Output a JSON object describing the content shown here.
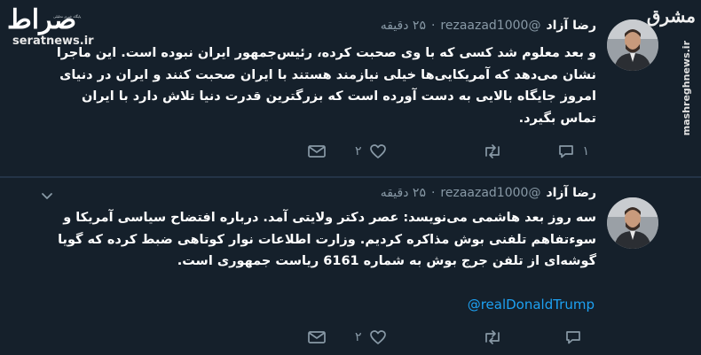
{
  "watermarks": {
    "left_logo": "صراط",
    "left_subtitle": "پایگاه خبری تحلیلی",
    "left_site": "seratnews.ir",
    "right_logo": "مشرق",
    "right_site": "mashreghnews.ir"
  },
  "tweets": [
    {
      "author": "رضا آزاد",
      "handle": "@rezaazad1000",
      "separator": "·",
      "time": "۲۵ دقیقه",
      "text": "و بعد معلوم شد کسی که با وی صحبت کرده، رئیس‌جمهور ایران نبوده است. این ماجرا نشان می‌دهد که آمریکایی‌ها خیلی نیازمند هستند با ایران صحبت کنند و ایران در دنیای امروز جایگاه بالایی به دست آورده است که بزرگترین قدرت دنیا تلاش دارد با ایران تماس بگیرد.",
      "mention": "",
      "reply_count": "۱",
      "retweet_count": "",
      "like_count": "۲",
      "icons": [
        "reply-icon",
        "retweet-icon",
        "heart-icon",
        "mail-icon"
      ]
    },
    {
      "author": "رضا آزاد",
      "handle": "@rezaazad1000",
      "separator": "·",
      "time": "۲۵ دقیقه",
      "text": "سه روز بعد هاشمی می‌نویسد: عصر دکتر ولایتی آمد. درباره افتضاح سیاسی آمریکا و سوءتفاهم تلفنی بوش مذاکره کردیم. وزارت اطلاعات نوار کوتاهی ضبط کرده که گویا گوشه‌ای از تلفن جرج بوش به شماره 6161 ریاست جمهوری است.",
      "mention": "@realDonaldTrump",
      "reply_count": "",
      "retweet_count": "",
      "like_count": "۲",
      "icons": [
        "reply-icon",
        "retweet-icon",
        "heart-icon",
        "mail-icon"
      ]
    }
  ],
  "colors": {
    "background": "#15202b",
    "secondary_text": "#8899a6",
    "link": "#1da1f2"
  }
}
